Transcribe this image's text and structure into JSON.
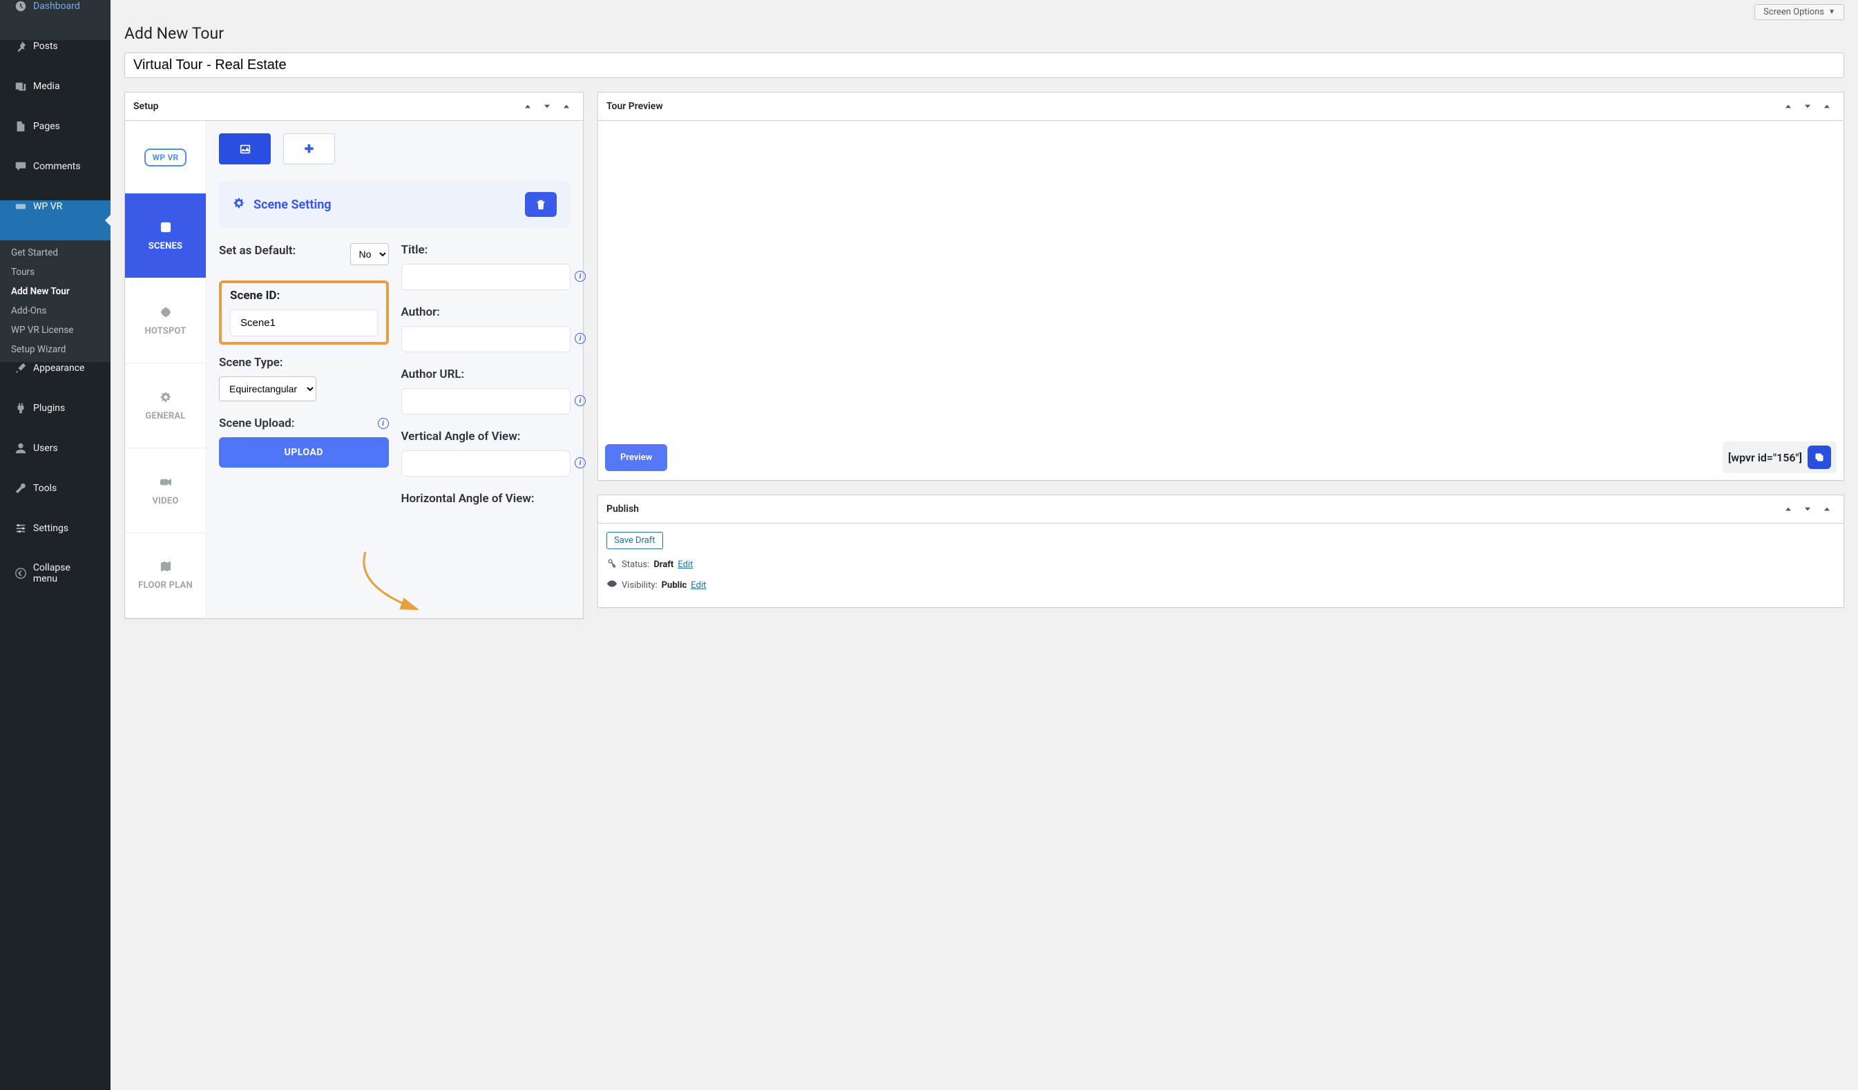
{
  "sidebar": {
    "dashboard": "Dashboard",
    "posts": "Posts",
    "media": "Media",
    "pages": "Pages",
    "comments": "Comments",
    "wpvr": "WP VR",
    "sub": {
      "get_started": "Get Started",
      "tours": "Tours",
      "add_new_tour": "Add New Tour",
      "addons": "Add-Ons",
      "license": "WP VR License",
      "wizard": "Setup Wizard"
    },
    "appearance": "Appearance",
    "plugins": "Plugins",
    "users": "Users",
    "tools": "Tools",
    "settings": "Settings",
    "collapse": "Collapse menu"
  },
  "top": {
    "screen_options": "Screen Options"
  },
  "page_title": "Add New Tour",
  "title_input": "Virtual Tour - Real Estate",
  "setup": {
    "header": "Setup"
  },
  "vtabs": {
    "logo": "WP VR",
    "scenes": "SCENES",
    "hotspot": "HOTSPOT",
    "general": "GENERAL",
    "video": "VIDEO",
    "floorplan": "FLOOR PLAN"
  },
  "scene": {
    "setting_title": "Scene Setting",
    "set_default": "Set as Default:",
    "default_val": "No",
    "scene_id_label": "Scene ID:",
    "scene_id_val": "Scene1",
    "scene_type_label": "Scene Type:",
    "scene_type_val": "Equirectangular",
    "scene_upload_label": "Scene Upload:",
    "upload_btn": "UPLOAD",
    "title_label": "Title:",
    "author_label": "Author:",
    "author_url_label": "Author URL:",
    "vertical_label": "Vertical Angle of View:",
    "horizontal_label": "Horizontal Angle of View:"
  },
  "preview": {
    "header": "Tour Preview",
    "button": "Preview",
    "shortcode": "[wpvr id=\"156\"]"
  },
  "publish": {
    "header": "Publish",
    "save_draft": "Save Draft",
    "status_label": "Status:",
    "status_val": "Draft",
    "visibility_label": "Visibility:",
    "visibility_val": "Public",
    "edit": "Edit"
  }
}
